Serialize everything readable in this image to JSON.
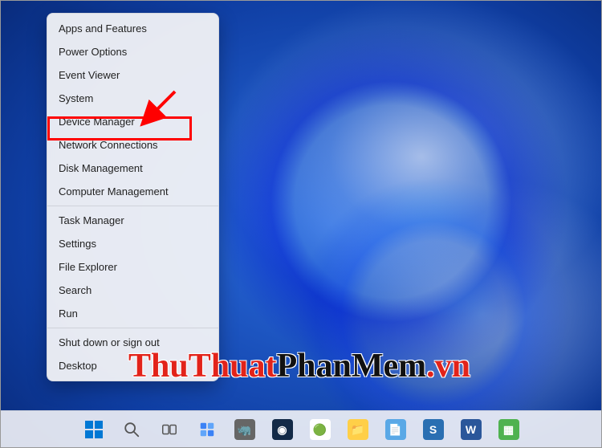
{
  "menu": {
    "groups": [
      [
        "Apps and Features",
        "Power Options",
        "Event Viewer",
        "System",
        "Device Manager",
        "Network Connections",
        "Disk Management",
        "Computer Management"
      ],
      [
        "Task Manager",
        "Settings",
        "File Explorer",
        "Search",
        "Run"
      ],
      [
        "Shut down or sign out",
        "Desktop"
      ]
    ],
    "highlighted": "Device Manager"
  },
  "watermark": {
    "part1": "ThuThuat",
    "part2": "PhanMem",
    "part3": ".vn"
  },
  "taskbar": {
    "items": [
      {
        "name": "start-button",
        "kind": "start"
      },
      {
        "name": "search-button",
        "kind": "search"
      },
      {
        "name": "task-view-button",
        "kind": "taskview"
      },
      {
        "name": "widgets-button",
        "kind": "widgets"
      },
      {
        "name": "app-rhino",
        "kind": "tile",
        "bg": "#666",
        "glyph": "🦏"
      },
      {
        "name": "app-steam",
        "kind": "tile",
        "bg": "#132a47",
        "glyph": "◉"
      },
      {
        "name": "app-garena",
        "kind": "tile",
        "bg": "#ffffff",
        "glyph": "🟢"
      },
      {
        "name": "file-explorer",
        "kind": "tile",
        "bg": "#ffcf48",
        "glyph": "📁"
      },
      {
        "name": "app-notepad",
        "kind": "tile",
        "bg": "#5aa8e6",
        "glyph": "📄"
      },
      {
        "name": "app-snagit",
        "kind": "tile",
        "bg": "#2a6fb2",
        "glyph": "S"
      },
      {
        "name": "app-word",
        "kind": "tile",
        "bg": "#2b579a",
        "glyph": "W"
      },
      {
        "name": "app-regedit",
        "kind": "tile",
        "bg": "#4fb24f",
        "glyph": "▦"
      }
    ]
  },
  "annotation": {
    "arrow_color": "#ff0000",
    "highlight_color": "#ff0000"
  }
}
